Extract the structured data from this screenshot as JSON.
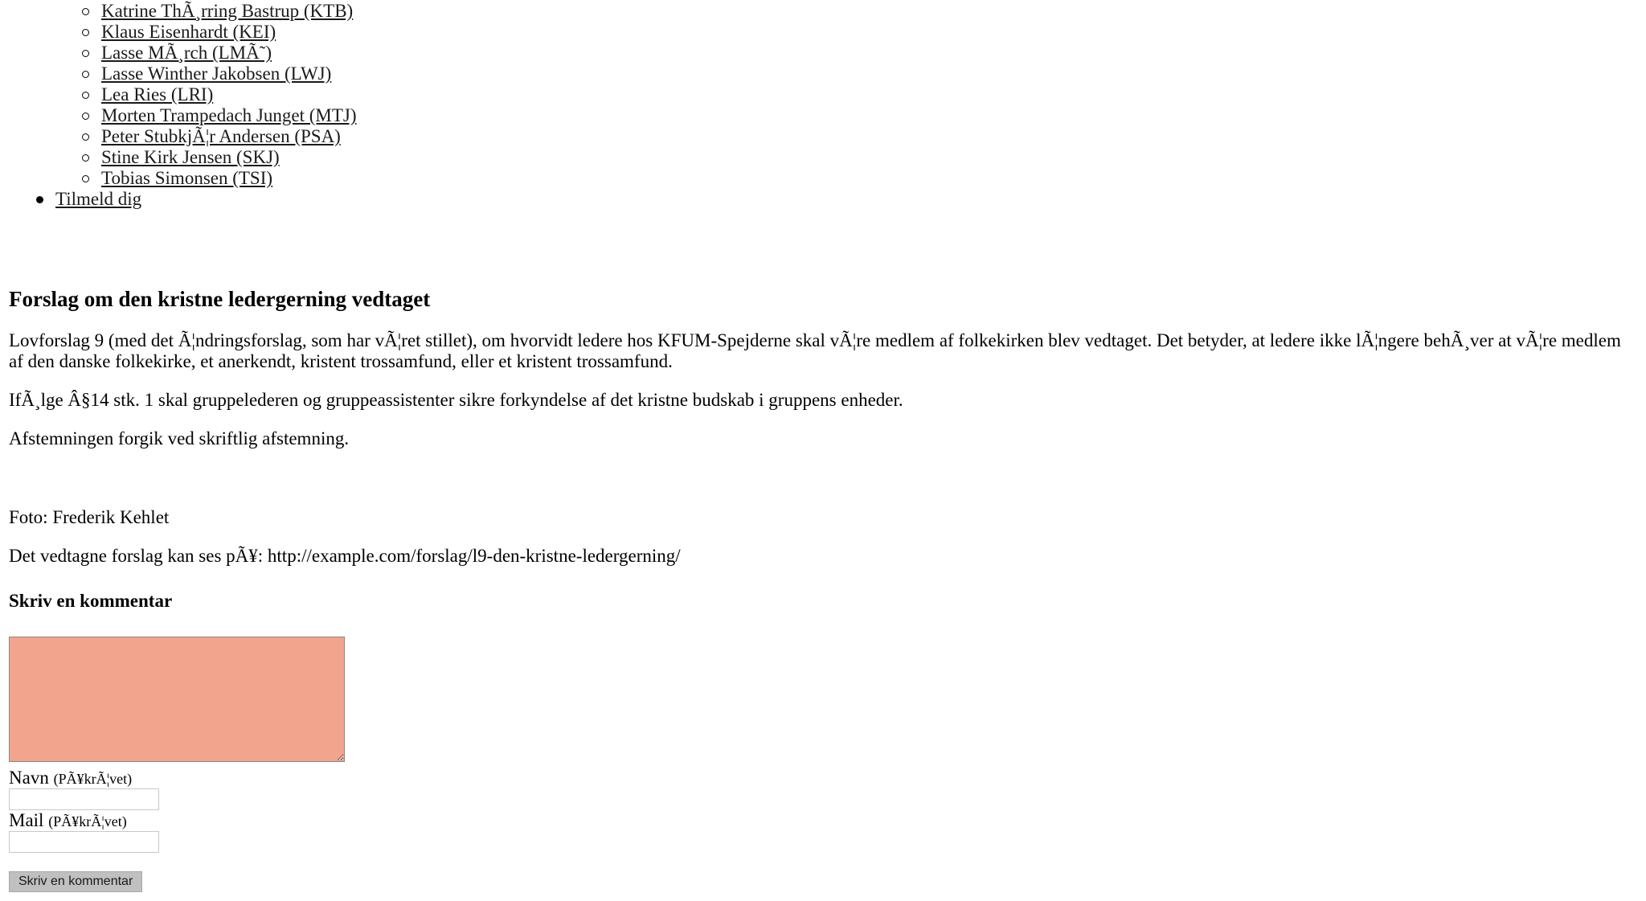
{
  "nav": {
    "sub_items": [
      {
        "label": "Katrine ThÃ¸rring Bastrup (KTB)"
      },
      {
        "label": "Klaus Eisenhardt (KEI)"
      },
      {
        "label": "Lasse MÃ¸rch (LMÃ˜)"
      },
      {
        "label": "Lasse Winther Jakobsen (LWJ)"
      },
      {
        "label": "Lea Ries (LRI)"
      },
      {
        "label": "Morten Trampedach Junget (MTJ)"
      },
      {
        "label": "Peter StubkjÃ¦r Andersen (PSA)"
      },
      {
        "label": "Stine Kirk Jensen (SKJ)"
      },
      {
        "label": "Tobias Simonsen (TSI)"
      }
    ],
    "top_item": "Tilmeld dig"
  },
  "article": {
    "title": "Forslag om den kristne ledergerning vedtaget",
    "p1": "Lovforslag 9 (med det Ã¦ndringsforslag, som har vÃ¦ret stillet), om hvorvidt ledere hos KFUM-Spejderne skal vÃ¦re medlem af folkekirken blev vedtaget. Det betyder, at ledere ikke lÃ¦ngere behÃ¸ver at vÃ¦re medlem af den danske folkekirke, et anerkendt, kristent trossamfund, eller et kristent trossamfund.",
    "p2": "IfÃ¸lge Â§14 stk. 1 skal gruppelederen og gruppeassistenter sikre forkyndelse af det kristne budskab i gruppens enheder.",
    "p3": "Afstemningen forgik ved skriftlig afstemning.",
    "photo_credit": "Foto: Frederik Kehlet",
    "link_text": "Det vedtagne forslag kan ses pÃ¥: http://example.com/forslag/l9-den-kristne-ledergerning/"
  },
  "comment_form": {
    "heading": "Skriv en kommentar",
    "comment_value": "",
    "name_label": "Navn",
    "name_required": "(PÃ¥krÃ¦vet)",
    "name_value": "",
    "mail_label": "Mail",
    "mail_required": "(PÃ¥krÃ¦vet)",
    "mail_value": "",
    "submit_label": "Skriv en kommentar"
  },
  "colors": {
    "textarea_bg": "#f2a48d",
    "button_bg": "#c0c0c0"
  }
}
